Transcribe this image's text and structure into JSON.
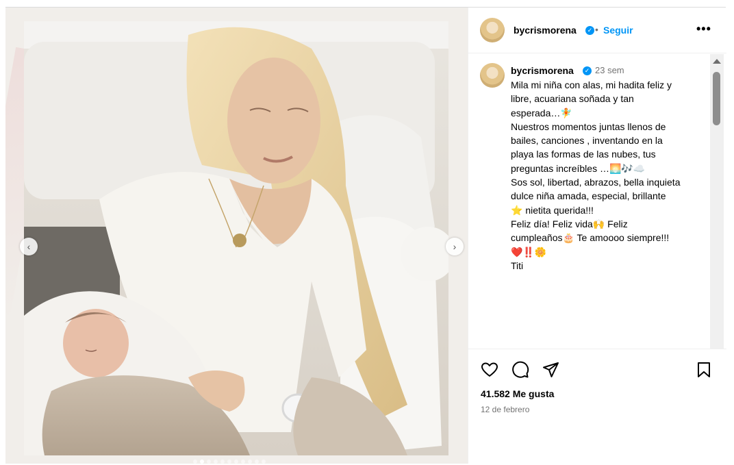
{
  "post": {
    "username": "bycrismorena",
    "separator": "•",
    "follow_label": "Seguir",
    "more_icon": "more-horizontal-icon",
    "time_ago": "23 sem",
    "caption": "Mila mi niña con alas, mi hadita feliz  y\nlibre, acuariana soñada y tan\nesperada…🧚\nNuestros momentos juntas llenos de\nbailes, canciones , inventando en la\nplaya las formas de las nubes, tus\npreguntas increíbles …🌅🎶☁️\nSos sol, libertad, abrazos, bella inquieta\ndulce niña amada, especial, brillante\n⭐ nietita querida!!!\nFeliz día! Feliz vida🙌 Feliz\ncumpleaños🎂 Te amoooo siempre!!!\n❤️‼️🌼\nTiti",
    "likes": "41.582 Me gusta",
    "date": "12 de febrero"
  },
  "carousel": {
    "prev_label": "‹",
    "next_label": "›",
    "dot_count": 11,
    "active_index": 1
  },
  "colors": {
    "accent": "#0095f6",
    "muted": "#737373",
    "border": "#dbdbdb"
  },
  "icons": [
    "heart-icon",
    "comment-icon",
    "share-icon",
    "bookmark-icon",
    "verified-badge-icon"
  ]
}
